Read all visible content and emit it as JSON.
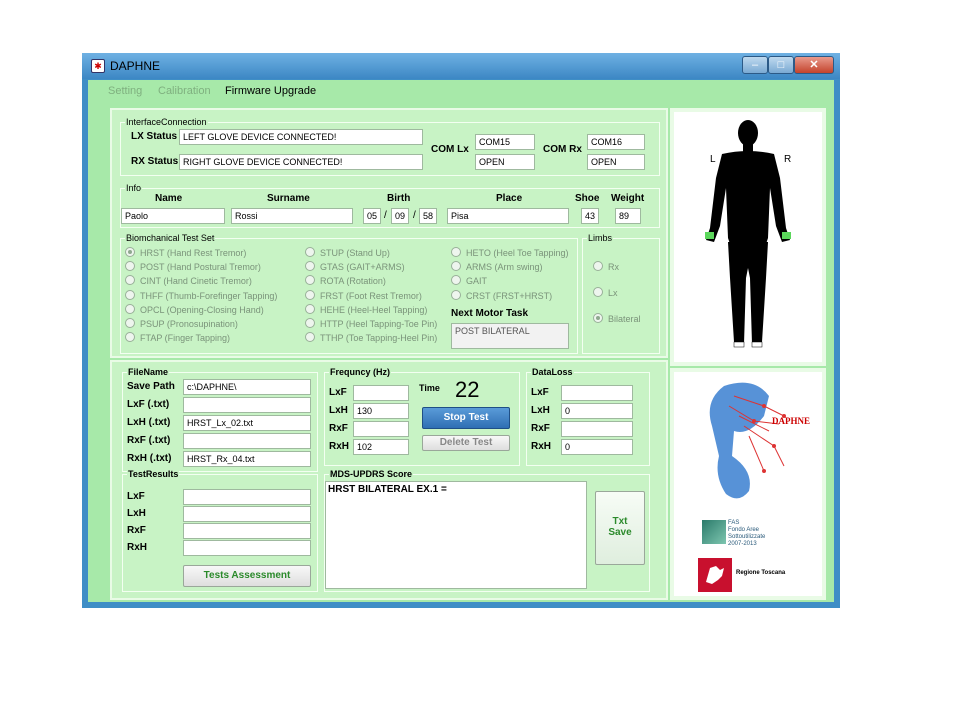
{
  "window": {
    "title": "DAPHNE",
    "icon": "app-icon",
    "minimize": "–",
    "maximize": "□",
    "close": "✕"
  },
  "menu": {
    "setting": "Setting",
    "calibration": "Calibration",
    "firmware": "Firmware Upgrade"
  },
  "interface": {
    "group_title": "InterfaceConnection",
    "lx_label": "LX Status",
    "lx_value": "LEFT GLOVE DEVICE CONNECTED!",
    "rx_label": "RX Status",
    "rx_value": "RIGHT GLOVE DEVICE CONNECTED!",
    "com_lx_label": "COM Lx",
    "com_lx_port": "COM15",
    "com_lx_state": "OPEN",
    "com_rx_label": "COM Rx",
    "com_rx_port": "COM16",
    "com_rx_state": "OPEN"
  },
  "info": {
    "group_title": "Info",
    "headers": {
      "name": "Name",
      "surname": "Surname",
      "birth": "Birth",
      "place": "Place",
      "shoe": "Shoe",
      "weight": "Weight"
    },
    "name": "Paolo",
    "surname": "Rossi",
    "birth_day": "05",
    "birth_month": "09",
    "birth_year": "58",
    "sep": "/",
    "place": "Pisa",
    "shoe": "43",
    "weight": "89"
  },
  "tests": {
    "group_title": "Biomchanical Test Set",
    "col1": [
      {
        "label": "HRST  (Hand Rest Tremor)",
        "selected": true
      },
      {
        "label": "POST  (Hand Postural Tremor)",
        "selected": false
      },
      {
        "label": "CINT  (Hand Cinetic Tremor)",
        "selected": false
      },
      {
        "label": "THFF  (Thumb-Forefinger Tapping)",
        "selected": false
      },
      {
        "label": "OPCL  (Opening-Closing Hand)",
        "selected": false
      },
      {
        "label": "PSUP  (Pronosupination)",
        "selected": false
      },
      {
        "label": "FTAP  (Finger Tapping)",
        "selected": false
      }
    ],
    "col2": [
      {
        "label": "STUP  (Stand Up)",
        "selected": false
      },
      {
        "label": "GTAS  (GAIT+ARMS)",
        "selected": false
      },
      {
        "label": "ROTA  (Rotation)",
        "selected": false
      },
      {
        "label": "FRST  (Foot Rest Tremor)",
        "selected": false
      },
      {
        "label": "HEHE  (Heel-Heel Tapping)",
        "selected": false
      },
      {
        "label": "HTTP  (Heel Tapping-Toe Pin)",
        "selected": false
      },
      {
        "label": "TTHP  (Toe Tapping-Heel Pin)",
        "selected": false
      }
    ],
    "col3": [
      {
        "label": "HETO  (Heel Toe Tapping)",
        "selected": false
      },
      {
        "label": "ARMS  (Arm swing)",
        "selected": false
      },
      {
        "label": "GAIT",
        "selected": false
      },
      {
        "label": "CRST  (FRST+HRST)",
        "selected": false
      }
    ],
    "next_label": "Next Motor Task",
    "next_value": "POST BILATERAL"
  },
  "limbs": {
    "group_title": "Limbs",
    "options": [
      {
        "label": "Rx",
        "selected": false
      },
      {
        "label": "Lx",
        "selected": false
      },
      {
        "label": "Bilateral",
        "selected": true
      }
    ]
  },
  "body": {
    "left": "L",
    "right": "R"
  },
  "file": {
    "group_title": "FileName",
    "save_path_label": "Save Path",
    "save_path": "c:\\DAPHNE\\",
    "lxf_label": "LxF (.txt)",
    "lxf": "",
    "lxh_label": "LxH (.txt)",
    "lxh": "HRST_Lx_02.txt",
    "rxf_label": "RxF (.txt)",
    "rxf": "",
    "rxh_label": "RxH (.txt)",
    "rxh": "HRST_Rx_04.txt"
  },
  "freq": {
    "group_title": "Frequncy (Hz)",
    "lxf_label": "LxF",
    "lxf": "",
    "lxh_label": "LxH",
    "lxh": "130",
    "rxf_label": "RxF",
    "rxf": "",
    "rxh_label": "RxH",
    "rxh": "102",
    "time_label": "Time",
    "time_value": "22",
    "stop_button": "Stop Test",
    "delete_button": "Delete Test"
  },
  "dataloss": {
    "group_title": "DataLoss",
    "lxf_label": "LxF",
    "lxf": "",
    "lxh_label": "LxH",
    "lxh": "0",
    "rxf_label": "RxF",
    "rxf": "",
    "rxh_label": "RxH",
    "rxh": "0"
  },
  "results": {
    "group_title": "TestResults",
    "lxf_label": "LxF",
    "lxh_label": "LxH",
    "rxf_label": "RxF",
    "rxh_label": "RxH",
    "assess_button": "Tests Assessment"
  },
  "score": {
    "group_title": "MDS-UPDRS Score",
    "text": "HRST BILATERAL EX.1  =",
    "save_button_l1": "Txt",
    "save_button_l2": "Save"
  },
  "logos": {
    "daphne": "DAPHNE",
    "fas_l1": "FAS",
    "fas_l2": "Fondo Aree",
    "fas_l3": "Sottoutilizzate",
    "fas_l4": "2007-2013",
    "toscana": "Regione Toscana"
  },
  "colors": {
    "window_bg": "#a7e9a9",
    "panel_bg": "#c8f3c5",
    "accent_button": "#3d7fc4",
    "glove_green": "#5bd65b"
  }
}
